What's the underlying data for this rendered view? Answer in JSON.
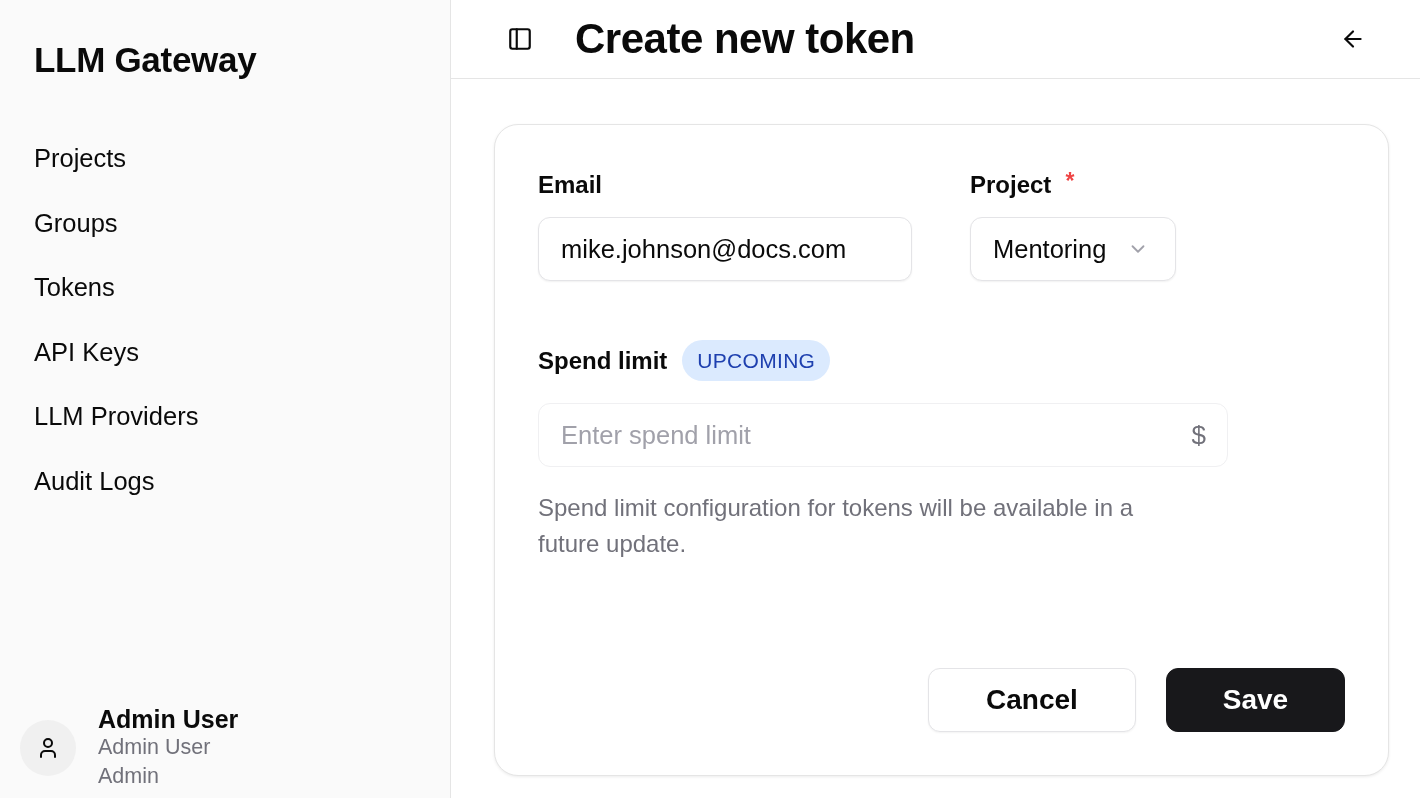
{
  "sidebar": {
    "title": "LLM Gateway",
    "nav_items": [
      {
        "label": "Projects"
      },
      {
        "label": "Groups"
      },
      {
        "label": "Tokens"
      },
      {
        "label": "API Keys"
      },
      {
        "label": "LLM Providers"
      },
      {
        "label": "Audit Logs"
      }
    ],
    "user": {
      "name": "Admin User",
      "display_name": "Admin User",
      "role": "Admin"
    }
  },
  "header": {
    "title": "Create new token"
  },
  "form": {
    "email": {
      "label": "Email",
      "value": "mike.johnson@docs.com"
    },
    "project": {
      "label": "Project",
      "required_mark": "*",
      "value": "Mentoring"
    },
    "spend_limit": {
      "label": "Spend limit",
      "badge": "UPCOMING",
      "placeholder": "Enter spend limit",
      "currency": "$",
      "disabled": true,
      "help": "Spend limit configuration for tokens will be available in a future update."
    }
  },
  "buttons": [
    {
      "label": "Cancel",
      "kind": "secondary"
    },
    {
      "label": "Save",
      "kind": "primary"
    }
  ]
}
